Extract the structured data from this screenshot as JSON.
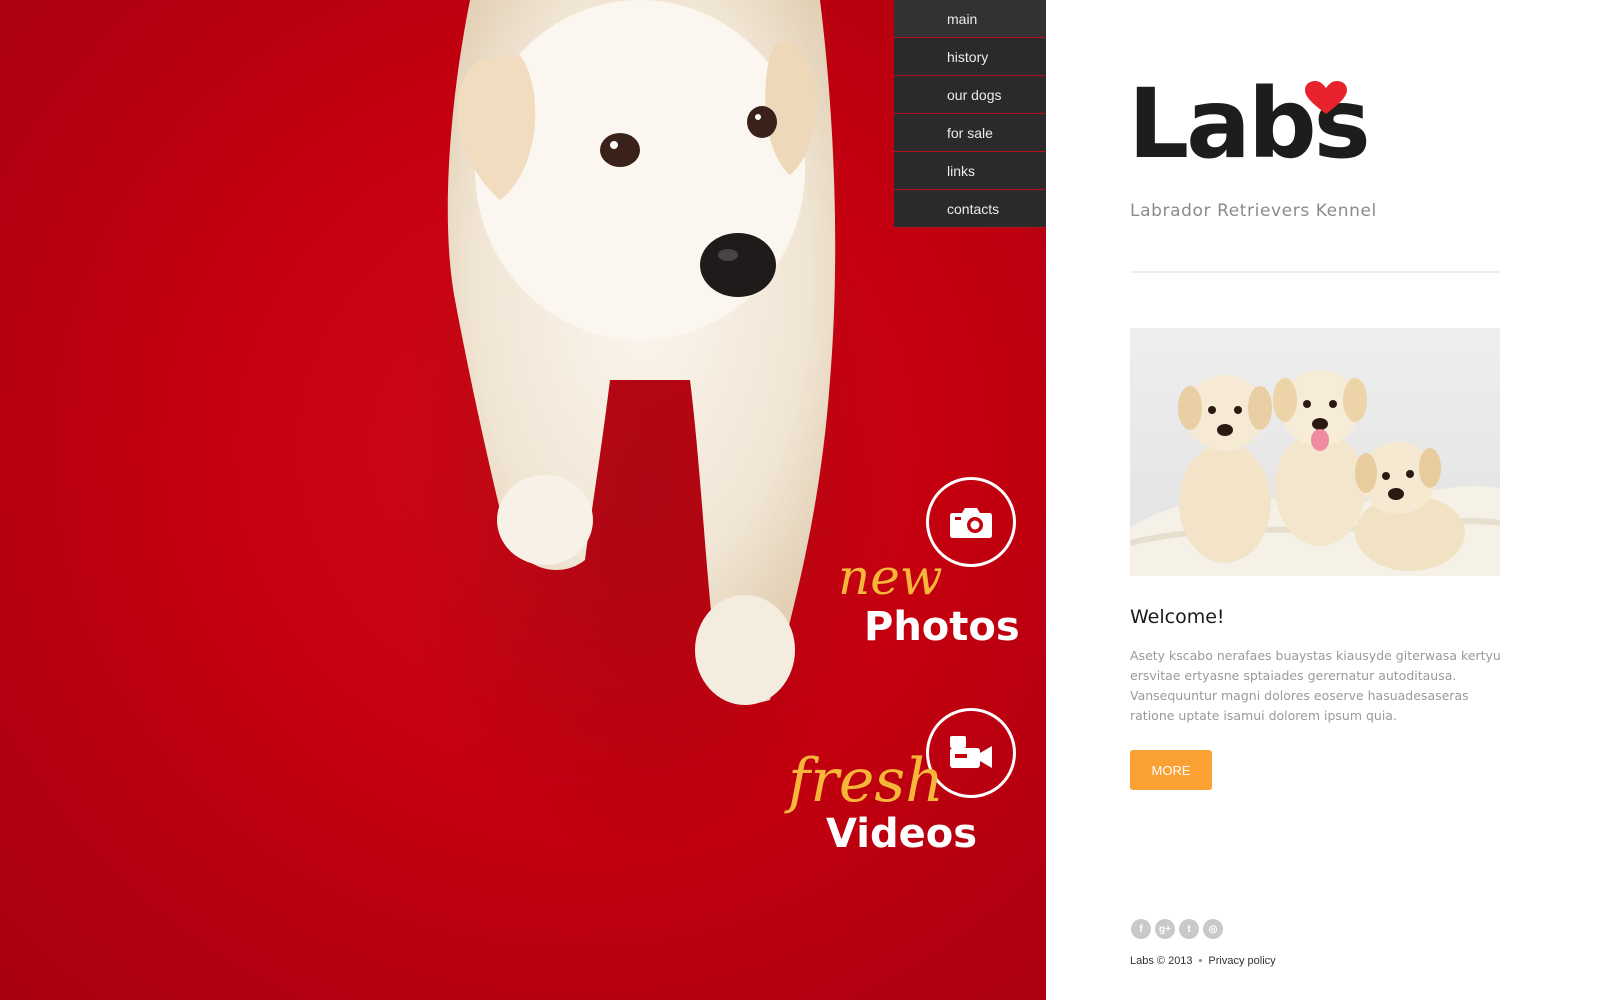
{
  "nav": {
    "items": [
      {
        "label": "main"
      },
      {
        "label": "history"
      },
      {
        "label": "our dogs"
      },
      {
        "label": "for sale"
      },
      {
        "label": "links"
      },
      {
        "label": "contacts"
      }
    ]
  },
  "promo": {
    "photos": {
      "script": "new",
      "title": "Photos",
      "icon": "camera-icon"
    },
    "videos": {
      "script": "fresh",
      "title": "Videos",
      "icon": "video-camera-icon"
    }
  },
  "brand": {
    "logo": "Labs",
    "logo_icon": "heart-icon",
    "tagline": "Labrador Retrievers Kennel"
  },
  "content": {
    "heading": "Welcome!",
    "body": "Asety kscabo nerafaes buaystas kiausyde giterwasa kertyu ersvitae ertyasne sptaiades gerernatur autoditausa. Vansequuntur magni dolores eoserve hasuadesaseras ratione uptate isamui dolorem ipsum quia.",
    "more_label": "MORE"
  },
  "social": [
    {
      "icon": "facebook-icon",
      "glyph": "f"
    },
    {
      "icon": "google-plus-icon",
      "glyph": "g+"
    },
    {
      "icon": "twitter-icon",
      "glyph": "t"
    },
    {
      "icon": "dribbble-icon",
      "glyph": "◎"
    }
  ],
  "footer": {
    "copyright": "Labs © 2013",
    "privacy": "Privacy policy"
  },
  "colors": {
    "hero_red": "#c4000f",
    "nav_bg": "#2a2a2a",
    "accent_orange": "#fba033",
    "script_gold": "#f6b63a",
    "heart_red": "#e8232d"
  }
}
